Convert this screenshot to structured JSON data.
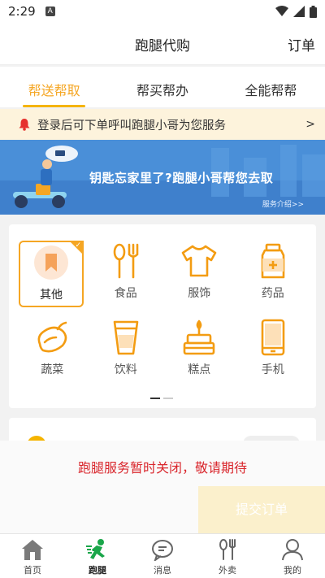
{
  "status_bar": {
    "time": "2:29",
    "notif_letter": "A"
  },
  "header": {
    "title": "跑腿代购",
    "orders_link": "订单"
  },
  "tabs": [
    {
      "label": "帮送帮取",
      "active": true
    },
    {
      "label": "帮买帮办",
      "active": false
    },
    {
      "label": "全能帮帮",
      "active": false
    }
  ],
  "notice": {
    "text": "登录后可下单呼叫跑腿小哥为您服务",
    "arrow": ">"
  },
  "banner": {
    "headline": "钥匙忘家里了?跑腿小哥帮您去取",
    "link": "服务介绍>>"
  },
  "categories": [
    {
      "label": "其他",
      "icon": "bookmark-icon",
      "selected": true
    },
    {
      "label": "食品",
      "icon": "spoon-fork-icon"
    },
    {
      "label": "服饰",
      "icon": "tshirt-icon"
    },
    {
      "label": "药品",
      "icon": "medicine-bottle-icon"
    },
    {
      "label": "蔬菜",
      "icon": "eggplant-icon"
    },
    {
      "label": "饮料",
      "icon": "cup-icon"
    },
    {
      "label": "糕点",
      "icon": "cake-icon"
    },
    {
      "label": "手机",
      "icon": "phone-icon"
    }
  ],
  "closed_message": "跑腿服务暂时关闭，敬请期待",
  "submit_button": "提交订单",
  "tabbar": [
    {
      "label": "首页",
      "icon": "home-icon"
    },
    {
      "label": "跑腿",
      "icon": "runner-icon",
      "active": true
    },
    {
      "label": "消息",
      "icon": "message-icon"
    },
    {
      "label": "外卖",
      "icon": "takeout-icon"
    },
    {
      "label": "我的",
      "icon": "profile-icon"
    }
  ],
  "colors": {
    "accent": "#f5a623",
    "notice_bg": "#fdf3dc",
    "banner_bg": "#4a8fd8",
    "closed_text": "#d9262c",
    "icon_orange": "#f39c12"
  }
}
